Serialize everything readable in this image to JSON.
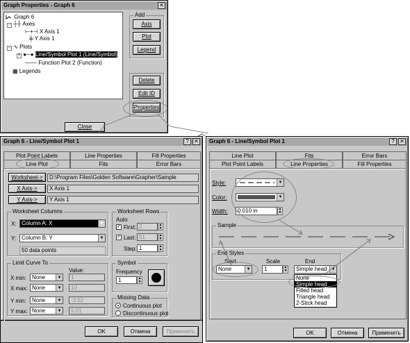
{
  "graph_props": {
    "title": "Graph Properties - Graph 6",
    "close_x": "✕",
    "tree": {
      "root": "Graph 6",
      "axes": "Axes",
      "x_axis": "X Axis 1",
      "y_axis": "Y Axis 1",
      "plots": "Plots",
      "plot1": "Line/Symbol Plot 1 (Line/Symbol)",
      "plot2": "Function Plot 2 (Function)",
      "legends": "Legends"
    },
    "add_label": "Add",
    "axis_btn": "Axis",
    "plot_btn": "Plot",
    "legend_btn": "Legend",
    "delete_btn": "Delete",
    "editid_btn": "Edit ID",
    "properties_btn": "Properties",
    "close_btn": "Close"
  },
  "left_dialog": {
    "title": "Graph 6 - Line/Symbol Plot 1",
    "help": "?",
    "close_x": "✕",
    "tabs_row1": [
      "Plot Point Labels",
      "Line Properties",
      "Fill Properties"
    ],
    "tabs_row2": [
      "Line Plot",
      "Fits",
      "Error Bars"
    ],
    "worksheet_btn": "Worksheet->",
    "worksheet_path": "D:\\Program Files\\Golden Software\\Grapher\\Sample",
    "xaxis_btn": "X Axis->",
    "xaxis_value": "X Axis 1",
    "yaxis_btn": "Y Axis->",
    "yaxis_value": "Y Axis 1",
    "wc_group": "Worksheet Columns",
    "x_label": "X:",
    "x_column": "Column A: X",
    "y_label": "Y:",
    "y_column": "Column B: Y",
    "data_points": "50 data points",
    "wr_group": "Worksheet Rows",
    "auto_label": "Auto",
    "first_label": "First:",
    "first_value": "2",
    "last_label": "Last:",
    "last_value": "51",
    "step_label": "Step:",
    "step_value": "1",
    "lc_group": "Limit Curve To",
    "value_header": "Value:",
    "xmin_label": "X min:",
    "xmin_sel": "None",
    "xmin_val": "1",
    "xmax_label": "X max:",
    "xmax_sel": "None",
    "xmax_val": "10",
    "ymin_label": "Y min:",
    "ymin_sel": "None",
    "ymin_val": "-3.52",
    "ymax_label": "Y max:",
    "ymax_sel": "None",
    "ymax_val": "5.01",
    "symbol_group": "Symbol",
    "frequency_label": "Frequency",
    "frequency_value": "1",
    "missing_group": "Missing Data",
    "continuous": "Continuous plot",
    "discontinuous": "Discontinuous plot",
    "ok": "OK",
    "cancel": "Отмена",
    "apply": "Применить"
  },
  "right_dialog": {
    "title": "Graph 6 - Line/Symbol Plot 1",
    "help": "?",
    "close_x": "✕",
    "tabs_row1": [
      "Line Plot",
      "Fits",
      "Error Bars"
    ],
    "tabs_row2": [
      "Plot Point Labels",
      "Line Properties",
      "Fill Properties"
    ],
    "style_label": "Style:",
    "color_label": "Color:",
    "width_label": "Width:",
    "width_value": "0.010 in",
    "sample_group": "Sample",
    "end_group": "End Styles",
    "start_label": "Start",
    "scale_label": "Scale",
    "end_label": "End",
    "start_value": "None",
    "scale_value": "1",
    "end_value": "Simple head",
    "end_options": [
      "None",
      "Simple head",
      "Filled head",
      "Triangle head",
      "2-Stick head"
    ],
    "end_selected": 1,
    "ok": "OK",
    "cancel": "Отмена",
    "apply": "Применить"
  },
  "colors": {
    "face": "#c8c8c8",
    "title": "#a8a8a8",
    "line_color": "#555555"
  }
}
